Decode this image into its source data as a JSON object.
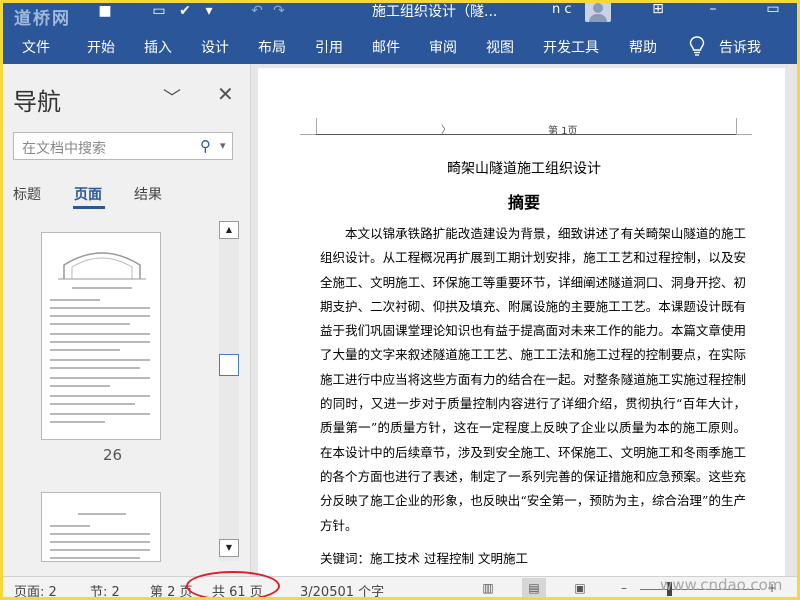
{
  "watermarks": {
    "top_left": "道桥网",
    "bottom_right": "www.cndao.com"
  },
  "titlebar": {
    "doc_title": "施工组织设计（隧...",
    "user_initials": "n c"
  },
  "ribbon": {
    "tabs": [
      "文件",
      "开始",
      "插入",
      "设计",
      "布局",
      "引用",
      "邮件",
      "审阅",
      "视图",
      "开发工具",
      "帮助",
      "告诉我"
    ]
  },
  "nav": {
    "title": "导航",
    "search_placeholder": "在文档中搜索",
    "tabs": [
      "标题",
      "页面",
      "结果"
    ],
    "active_tab": "页面",
    "thumb_page": "26"
  },
  "document": {
    "header_mark": "〉",
    "header_page": "第 1页",
    "heading": "畸架山隧道施工组织设计",
    "abstract_title": "摘要",
    "abstract": "本文以锦承铁路扩能改造建设为背景，细致讲述了有关畸架山隧道的施工组织设计。从工程概况再扩展到工期计划安排，施工工艺和过程控制，以及安全施工、文明施工、环保施工等重要环节，详细阐述隧道洞口、洞身开挖、初期支护、二次衬砌、仰拱及填充、附属设施的主要施工工艺。本课题设计既有益于我们巩固课堂理论知识也有益于提高面对未来工作的能力。本篇文章使用了大量的文字来叙述隧道施工工艺、施工工法和施工过程的控制要点，在实际施工进行中应当将这些方面有力的结合在一起。对整条隧道施工实施过程控制的同时，又进一步对于质量控制内容进行了详细介绍，贯彻执行“百年大计，质量第一”的质量方针，这在一定程度上反映了企业以质量为本的施工原则。在本设计中的后续章节，涉及到安全施工、环保施工、文明施工和冬雨季施工的各个方面也进行了表述，制定了一系列完善的保证措施和应急预案。这些充分反映了施工企业的形象，也反映出“安全第一，预防为主，综合治理”的生产方针。",
    "keywords": "关键词：施工技术 过程控制 文明施工"
  },
  "status": {
    "page": "页面: 2",
    "section": "节: 2",
    "page_of": "第 2 页",
    "total_pages": "共 61 页",
    "words": "3/20501 个字"
  },
  "colors": {
    "ribbon": "#2b579a",
    "highlight_circle": "#e01d2a",
    "frame": "#f5d93a"
  }
}
